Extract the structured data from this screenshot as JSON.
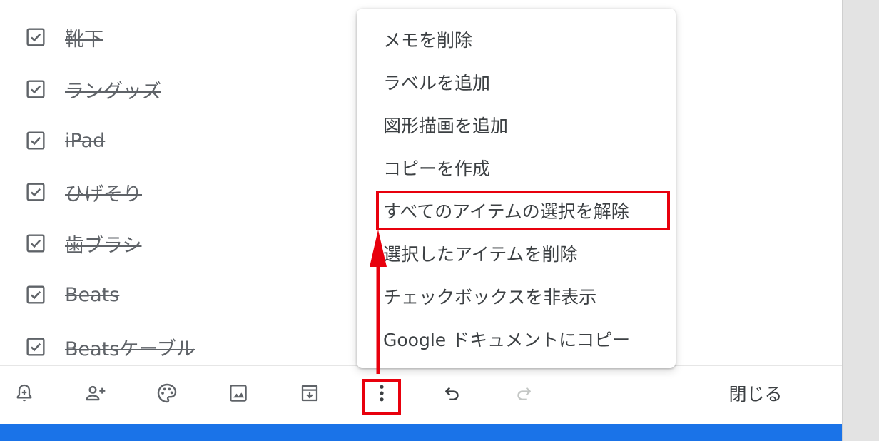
{
  "checklist": {
    "items": [
      {
        "text": "靴下",
        "checked": true
      },
      {
        "text": "ラングッズ",
        "checked": true
      },
      {
        "text": "iPad",
        "checked": true
      },
      {
        "text": "ひげそり",
        "checked": true
      },
      {
        "text": "歯ブラシ",
        "checked": true
      },
      {
        "text": "Beats",
        "checked": true
      },
      {
        "text": "Beatsケーブル",
        "checked": true
      }
    ]
  },
  "menu": {
    "items": [
      {
        "label": "メモを削除"
      },
      {
        "label": "ラベルを追加"
      },
      {
        "label": "図形描画を追加"
      },
      {
        "label": "コピーを作成"
      },
      {
        "label": "すべてのアイテムの選択を解除"
      },
      {
        "label": "選択したアイテムを削除"
      },
      {
        "label": "チェックボックスを非表示"
      },
      {
        "label": "Google ドキュメントにコピー"
      }
    ]
  },
  "toolbar": {
    "icons": [
      "reminder-bell-icon",
      "collaborator-icon",
      "palette-icon",
      "image-icon",
      "archive-icon",
      "more-vert-icon",
      "undo-icon",
      "redo-icon"
    ],
    "close_label": "閉じる"
  },
  "colors": {
    "highlight": "#e8000d",
    "accent_bar": "#1a73e8",
    "icon": "#5f6368",
    "icon_disabled": "#c4c7c5"
  }
}
